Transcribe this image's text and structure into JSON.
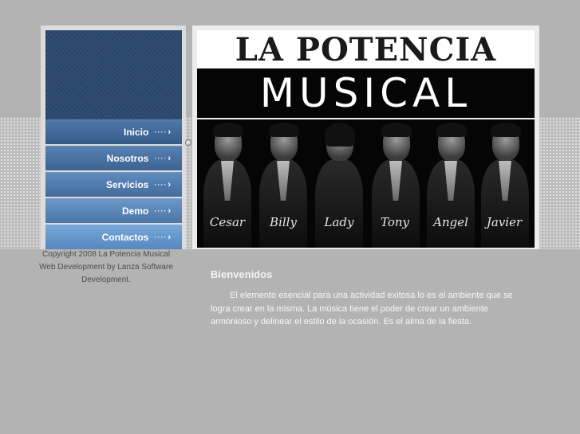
{
  "logo": {
    "line1": "LA POTENCIA",
    "line2": "MUSICAL"
  },
  "menu": {
    "items": [
      {
        "label": "Inicio"
      },
      {
        "label": "Nosotros"
      },
      {
        "label": "Servicios"
      },
      {
        "label": "Demo"
      },
      {
        "label": "Contactos"
      }
    ],
    "dots": "····",
    "arrow": "›"
  },
  "band_members": [
    "Cesar",
    "Billy",
    "Lady",
    "Tony",
    "Angel",
    "Javier"
  ],
  "footer": {
    "line1": "Copyright 2008 La Potencia Musical",
    "line2": "Web Development by Lanza Software",
    "line3": "Development."
  },
  "main": {
    "heading": "Bienvenidos",
    "body": "El elemento esencial para una actividad exitosa lo es el ambiente que se logra crear en la misma. La música tiene el poder de crear un ambiente armonioso y delinear el estilo de la ocasión. Es el alma de la fiesta."
  },
  "colors": {
    "background": "#b3b3b3",
    "nav_dark": "#355a86",
    "nav_light": "#78a7d8",
    "header_panel": "#2c4a6e"
  }
}
